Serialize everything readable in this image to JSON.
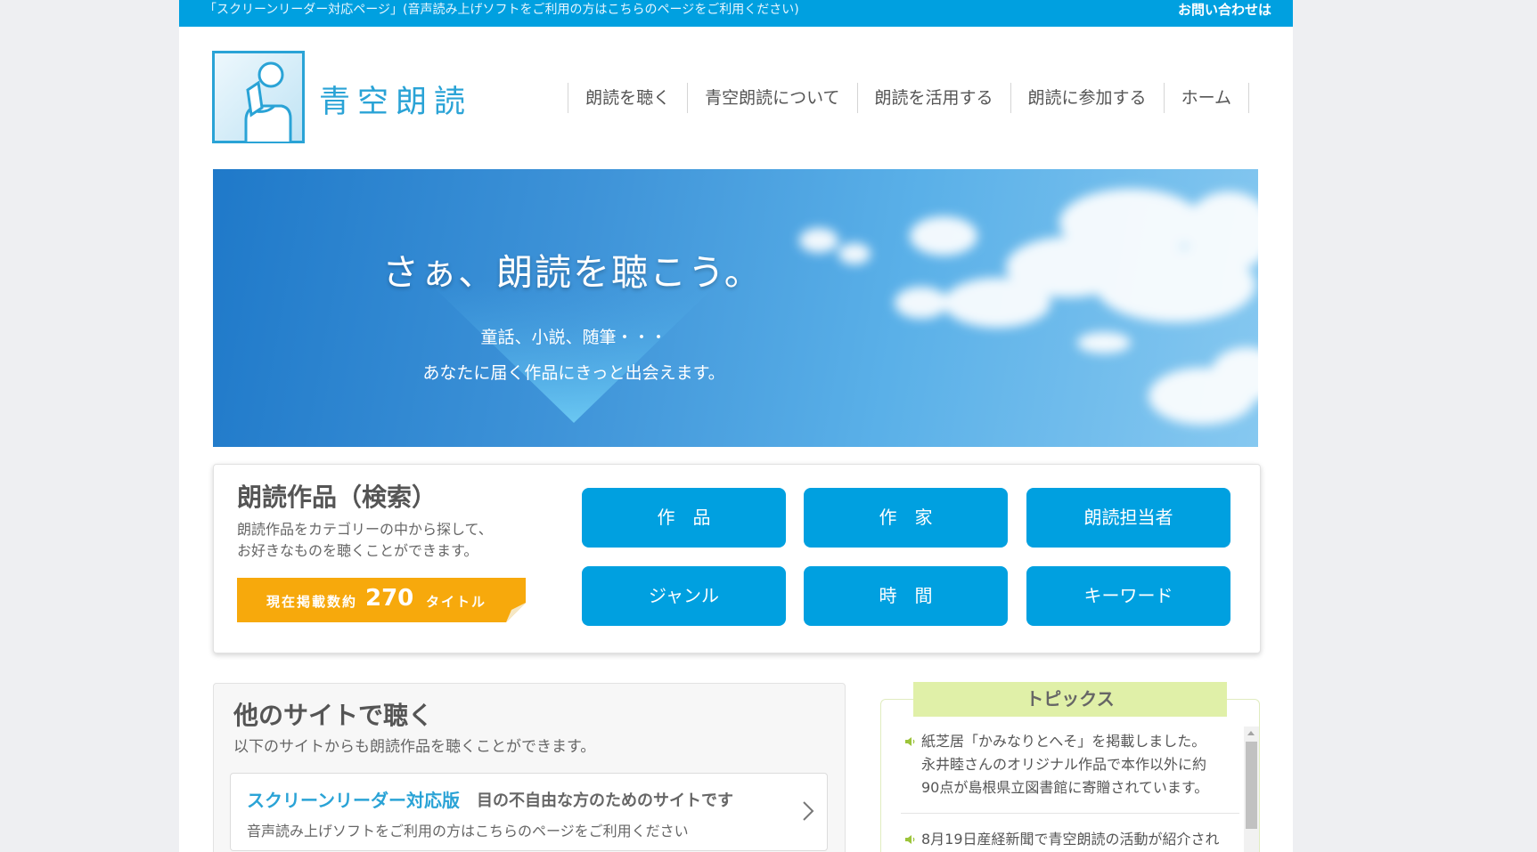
{
  "topbar": {
    "screen_reader_link": "「スクリーンリーダー対応ページ」(音声読み上げソフトをご利用の方はこちらのページをご利用ください)",
    "contact": "お問い合わせは"
  },
  "logo": {
    "text": "青空朗読"
  },
  "nav": {
    "items": [
      "朗読を聴く",
      "青空朗読について",
      "朗読を活用する",
      "朗読に参加する",
      "ホーム"
    ]
  },
  "hero": {
    "title": "さぁ、朗読を聴こう。",
    "sub1": "童話、小説、随筆・・・",
    "sub2": "あなたに届く作品にきっと出会えます。"
  },
  "search": {
    "title": "朗読作品（検索）",
    "desc1": "朗読作品をカテゴリーの中から探して、",
    "desc2": "お好きなものを聴くことができます。",
    "count_label": "現在掲載数約",
    "count_value": "270",
    "count_unit": "タイトル",
    "buttons": [
      "作　品",
      "作　家",
      "朗読担当者",
      "ジャンル",
      "時　間",
      "キーワード"
    ]
  },
  "other_sites": {
    "title": "他のサイトで聴く",
    "desc": "以下のサイトからも朗読作品を聴くことができます。",
    "card_name": "スクリーンリーダー対応版",
    "card_tag": "目の不自由な方のためのサイトです",
    "card_note": "音声読み上げソフトをご利用の方はこちらのページをご利用ください"
  },
  "topics": {
    "title": "トピックス",
    "item1_line1": "紙芝居「かみなりとへそ」を掲載しました。",
    "item1_line2": "永井睦さんのオリジナル作品で本作以外に約",
    "item1_line3": "90点が島根県立図書館に寄贈されています。",
    "item2_line1": "8月19日産経新聞で青空朗読の活動が紹介され"
  },
  "colors": {
    "accent": "#00a0e0",
    "badge": "#f7a90c",
    "topics_head": "#e0f0a8"
  }
}
